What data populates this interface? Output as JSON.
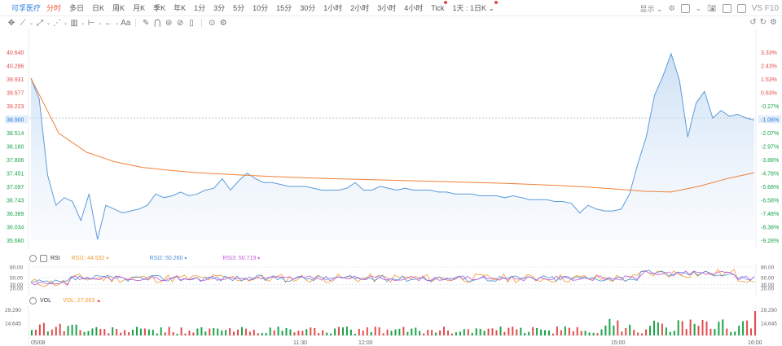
{
  "stock_name": "可孚医疗",
  "periods": [
    {
      "label": "分时",
      "active": true
    },
    {
      "label": "多日"
    },
    {
      "label": "日K"
    },
    {
      "label": "周K"
    },
    {
      "label": "月K"
    },
    {
      "label": "季K"
    },
    {
      "label": "年K"
    },
    {
      "label": "1分"
    },
    {
      "label": "3分"
    },
    {
      "label": "5分"
    },
    {
      "label": "10分"
    },
    {
      "label": "15分"
    },
    {
      "label": "30分"
    },
    {
      "label": "1小时"
    },
    {
      "label": "2小时"
    },
    {
      "label": "3小时"
    },
    {
      "label": "4小时"
    },
    {
      "label": "Tick",
      "dot": true
    },
    {
      "label": "1天 : 1日K",
      "dot": true,
      "dropdown": true
    }
  ],
  "right_tools": {
    "display_label": "显示",
    "vsf10_label": "VS F10"
  },
  "toolbar_icons": [
    "crosshair-icon",
    "line-icon",
    "fib-icon",
    "pattern-icon",
    "range-icon",
    "arrow-icon",
    "text-icon",
    "pen-icon",
    "magnet-icon",
    "lock-icon",
    "eye-off-icon",
    "trash-icon",
    "compare-icon",
    "settings-icon"
  ],
  "main_chart": {
    "left_prices": [
      "40.640",
      "40.286",
      "39.931",
      "39.577",
      "39.223",
      "38.900",
      "38.514",
      "38.160",
      "37.806",
      "37.451",
      "37.097",
      "36.743",
      "36.389",
      "36.034",
      "35.680"
    ],
    "right_pct": [
      "3.33%",
      "2.43%",
      "1.53%",
      "0.63%",
      "-0.27%",
      "-1.08%",
      "-2.07%",
      "-2.97%",
      "-3.88%",
      "-4.78%",
      "-5.68%",
      "-6.58%",
      "-7.48%",
      "-8.38%",
      "-9.28%"
    ],
    "current_price": "38.900",
    "current_pct": "-1.08%",
    "price_line": [
      39.95,
      39.4,
      37.4,
      36.6,
      36.8,
      36.7,
      36.2,
      36.9,
      35.7,
      36.6,
      36.5,
      36.4,
      36.45,
      36.5,
      36.6,
      36.9,
      36.8,
      36.85,
      36.95,
      36.85,
      36.9,
      37.0,
      37.05,
      37.3,
      37.0,
      37.25,
      37.45,
      37.3,
      37.2,
      37.2,
      37.15,
      37.1,
      37.1,
      37.1,
      37.05,
      37.0,
      37.0,
      37.0,
      37.05,
      37.2,
      37.0,
      37.0,
      37.1,
      37.05,
      37.0,
      37.05,
      37.0,
      37.0,
      37.0,
      36.95,
      36.95,
      36.9,
      36.9,
      36.9,
      36.85,
      36.85,
      36.85,
      36.8,
      36.85,
      36.8,
      36.75,
      36.75,
      36.75,
      36.7,
      36.7,
      36.65,
      36.4,
      36.6,
      36.5,
      36.45,
      36.45,
      36.5,
      36.9,
      37.7,
      38.4,
      39.5,
      40.0,
      40.6,
      39.9,
      38.4,
      39.3,
      39.6,
      38.9,
      39.1,
      38.95,
      39.0,
      38.9,
      38.85
    ],
    "avg_line": [
      39.95,
      38.5,
      38.0,
      37.75,
      37.6,
      37.52,
      37.46,
      37.42,
      37.38,
      37.35,
      37.32,
      37.3,
      37.28,
      37.26,
      37.24,
      37.22,
      37.2,
      37.18,
      37.15,
      37.12,
      37.08,
      37.03,
      36.97,
      36.95,
      37.1,
      37.3,
      37.46
    ]
  },
  "rsi": {
    "label": "RSI",
    "items": [
      {
        "name": "RSI1",
        "value": "44.532",
        "color": "#f29b30"
      },
      {
        "name": "RSI2",
        "value": "50.260",
        "color": "#4a90d9"
      },
      {
        "name": "RSI3",
        "value": "50.719",
        "color": "#c05ad8"
      }
    ],
    "levels": [
      "80.00",
      "50.00",
      "30.00",
      "20.00"
    ]
  },
  "vol": {
    "label": "VOL",
    "item": {
      "name": "VOL",
      "value": "27,053",
      "color": "#f29b30"
    },
    "left_ticks": [
      "29,290",
      "14,645"
    ],
    "right_ticks": [
      "29,290",
      "14,645"
    ]
  },
  "time_axis": [
    "05/08",
    "11:30",
    "12:00",
    "15:00",
    "16:00"
  ],
  "colors": {
    "up": "#e34b4b",
    "down": "#1aa34a",
    "line": "#5b9bd9",
    "avg": "#f0803a",
    "active": "#e65a2e",
    "link": "#2b7bd9"
  }
}
